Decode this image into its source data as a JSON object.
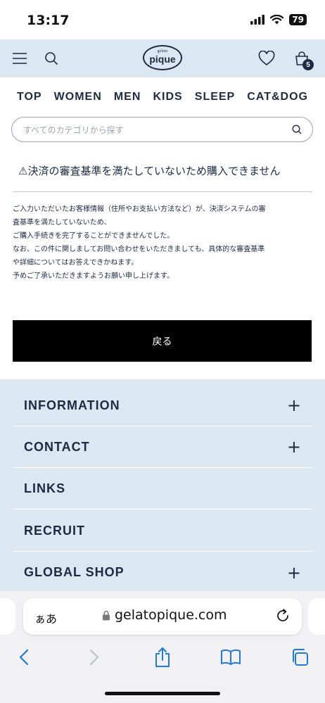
{
  "status": {
    "time": "13:17",
    "battery": "79"
  },
  "header": {
    "logo_small": "gelato",
    "logo_big": "pique",
    "cart_count": "5"
  },
  "nav": [
    "TOP",
    "WOMEN",
    "MEN",
    "KIDS",
    "SLEEP",
    "CAT&DOG"
  ],
  "search": {
    "placeholder": "すべてのカテゴリから探す"
  },
  "error": {
    "title": "⚠決済の審査基準を満たしていないため購入できません",
    "lines": [
      "ご入力いただいたお客様情報（住所やお支払い方法など）が、決済システムの審",
      "査基準を満たしていないため、",
      "ご購入手続きを完了することができませんでした。",
      "なお、この件に関しましてお問い合わせをいただきましても、具体的な審査基準",
      "や詳細についてはお答えできかねます。",
      "予めご了承いただきますようお願い申し上げます。"
    ],
    "back_label": "戻る"
  },
  "footer": {
    "items": [
      {
        "label": "INFORMATION",
        "expand": "+"
      },
      {
        "label": "CONTACT",
        "expand": "+"
      },
      {
        "label": "LINKS",
        "expand": ""
      },
      {
        "label": "RECRUIT",
        "expand": ""
      },
      {
        "label": "GLOBAL SHOP",
        "expand": "+"
      }
    ]
  },
  "browser": {
    "aa_label": "ぁあ",
    "url": "gelatopique.com"
  },
  "colors": {
    "accent": "#1c2a44",
    "header_bg": "#dce8f1",
    "button_bg": "#000000"
  }
}
